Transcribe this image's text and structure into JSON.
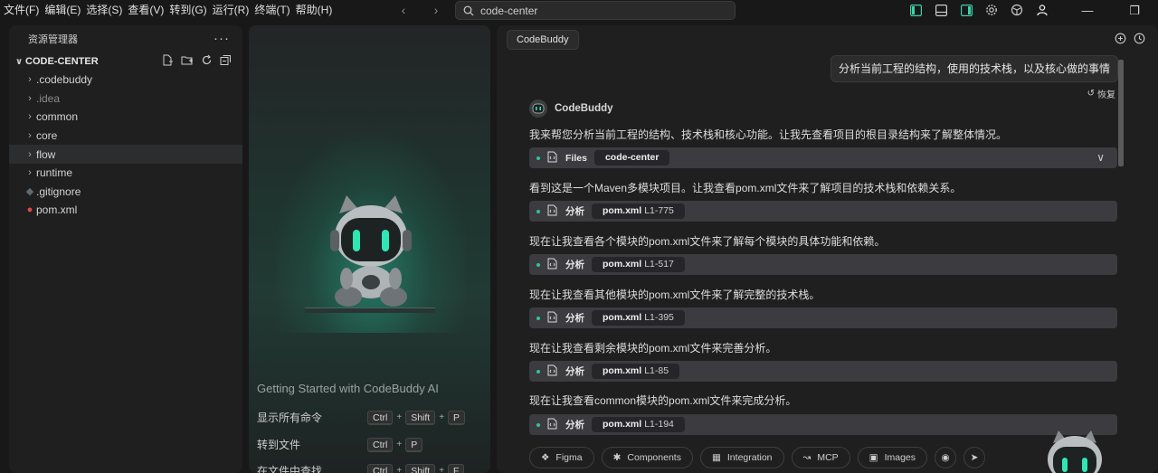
{
  "menu": [
    "文件(F)",
    "编辑(E)",
    "选择(S)",
    "查看(V)",
    "转到(G)",
    "运行(R)",
    "终端(T)",
    "帮助(H)"
  ],
  "search": {
    "value": "code-center"
  },
  "titlebar_icons": [
    "toggle-primary-sidebar-icon",
    "toggle-panel-icon",
    "toggle-secondary-sidebar-icon",
    "settings-gear-icon",
    "extension-icon",
    "account-icon"
  ],
  "explorer": {
    "title": "资源管理器",
    "project": "CODE-CENTER",
    "items": [
      {
        "label": ".codebuddy",
        "type": "folder"
      },
      {
        "label": ".idea",
        "type": "folder"
      },
      {
        "label": "common",
        "type": "folder"
      },
      {
        "label": "core",
        "type": "folder"
      },
      {
        "label": "flow",
        "type": "folder"
      },
      {
        "label": "runtime",
        "type": "folder"
      },
      {
        "label": ".gitignore",
        "type": "file"
      },
      {
        "label": "pom.xml",
        "type": "file"
      }
    ]
  },
  "welcome": {
    "title": "Getting Started with CodeBuddy AI",
    "commands": [
      {
        "label": "显示所有命令",
        "keys": [
          "Ctrl",
          "Shift",
          "P"
        ]
      },
      {
        "label": "转到文件",
        "keys": [
          "Ctrl",
          "P"
        ]
      },
      {
        "label": "在文件中查找",
        "keys": [
          "Ctrl",
          "Shift",
          "F"
        ]
      }
    ]
  },
  "chat": {
    "tab": "CodeBuddy",
    "user_message": "分析当前工程的结构，使用的技术栈，以及核心做的事情",
    "restore_label": "恢复",
    "bot_name": "CodeBuddy",
    "blocks": [
      {
        "text": "我来帮您分析当前工程的结构、技术栈和核心功能。让我先查看项目的根目录结构来了解整体情况。",
        "tool": {
          "name": "Files",
          "target": "code-center",
          "range": ""
        }
      },
      {
        "text": "看到这是一个Maven多模块项目。让我查看pom.xml文件来了解项目的技术栈和依赖关系。",
        "tool": {
          "name": "分析",
          "target": "pom.xml",
          "range": "L1-775"
        }
      },
      {
        "text": "现在让我查看各个模块的pom.xml文件来了解每个模块的具体功能和依赖。",
        "tool": {
          "name": "分析",
          "target": "pom.xml",
          "range": "L1-517"
        }
      },
      {
        "text": "现在让我查看其他模块的pom.xml文件来了解完整的技术栈。",
        "tool": {
          "name": "分析",
          "target": "pom.xml",
          "range": "L1-395"
        }
      },
      {
        "text": "现在让我查看剩余模块的pom.xml文件来完善分析。",
        "tool": {
          "name": "分析",
          "target": "pom.xml",
          "range": "L1-85"
        }
      },
      {
        "text": "现在让我查看common模块的pom.xml文件来完成分析。",
        "tool": {
          "name": "分析",
          "target": "pom.xml",
          "range": "L1-194"
        }
      }
    ],
    "bottom_pills": [
      "Figma",
      "Components",
      "Integration",
      "MCP",
      "Images"
    ]
  }
}
